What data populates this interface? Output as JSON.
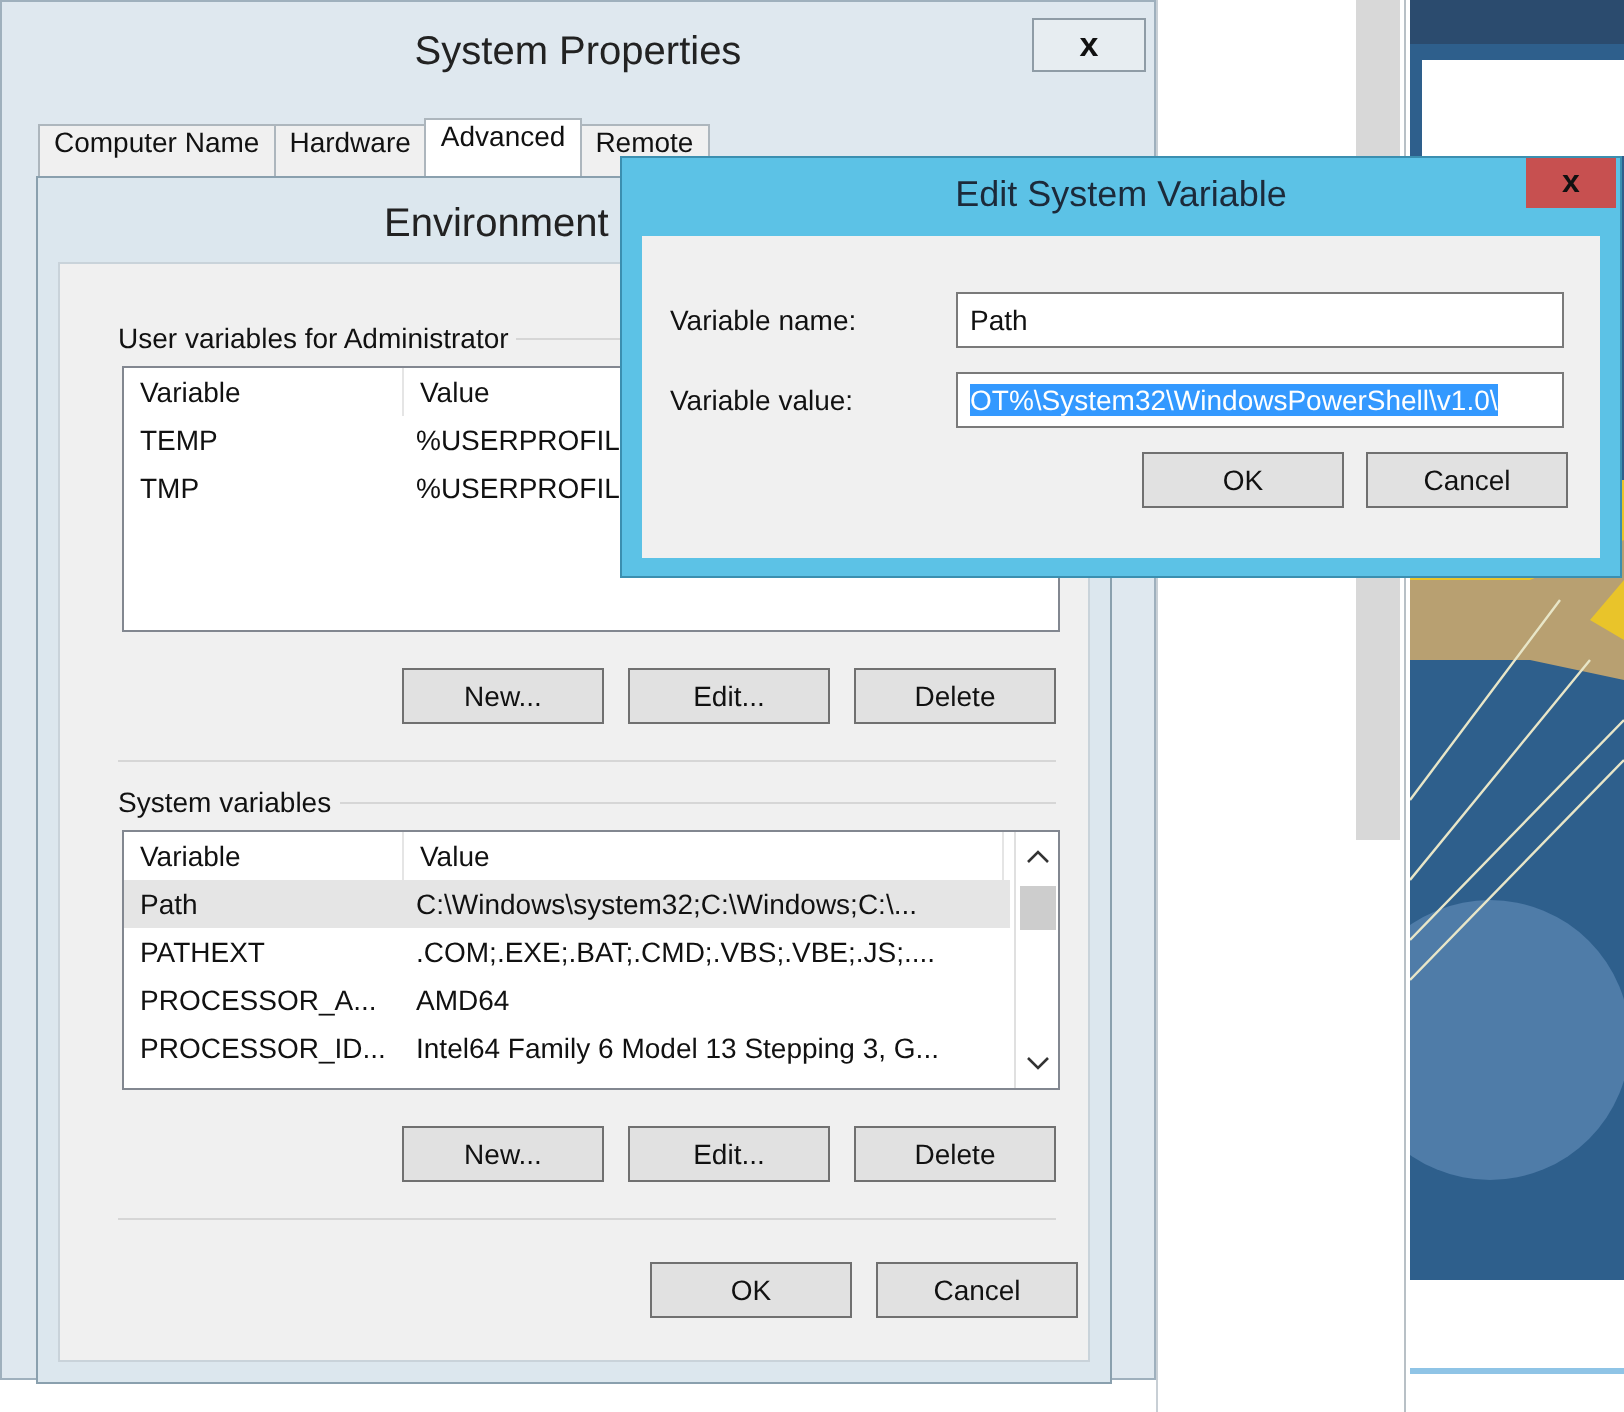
{
  "system_properties": {
    "title": "System Properties",
    "close": "x",
    "tabs": [
      {
        "label": "Computer Name",
        "selected": false
      },
      {
        "label": "Hardware",
        "selected": false
      },
      {
        "label": "Advanced",
        "selected": true
      },
      {
        "label": "Remote",
        "selected": false
      }
    ]
  },
  "environment_variables": {
    "title": "Environment",
    "user_group": {
      "title": "User variables for Administrator",
      "columns": [
        "Variable",
        "Value"
      ],
      "rows": [
        {
          "cells": [
            "TEMP",
            "%USERPROFIL"
          ],
          "selected": false
        },
        {
          "cells": [
            "TMP",
            "%USERPROFIL"
          ],
          "selected": false
        }
      ],
      "buttons": [
        "New...",
        "Edit...",
        "Delete"
      ]
    },
    "system_group": {
      "title": "System variables",
      "columns": [
        "Variable",
        "Value"
      ],
      "rows": [
        {
          "cells": [
            "Path",
            "C:\\Windows\\system32;C:\\Windows;C:\\..."
          ],
          "selected": true
        },
        {
          "cells": [
            "PATHEXT",
            ".COM;.EXE;.BAT;.CMD;.VBS;.VBE;.JS;...."
          ],
          "selected": false
        },
        {
          "cells": [
            "PROCESSOR_A...",
            "AMD64"
          ],
          "selected": false
        },
        {
          "cells": [
            "PROCESSOR_ID...",
            "Intel64 Family 6 Model 13 Stepping 3, G..."
          ],
          "selected": false
        }
      ],
      "buttons": [
        "New...",
        "Edit...",
        "Delete"
      ]
    },
    "buttons": [
      "OK",
      "Cancel"
    ]
  },
  "edit_dialog": {
    "title": "Edit System Variable",
    "close": "x",
    "fields": [
      {
        "label": "Variable name:",
        "value": "Path",
        "selected": false
      },
      {
        "label": "Variable value:",
        "value": "OT%\\System32\\WindowsPowerShell\\v1.0\\",
        "selected": true
      }
    ],
    "buttons": [
      "OK",
      "Cancel"
    ]
  }
}
